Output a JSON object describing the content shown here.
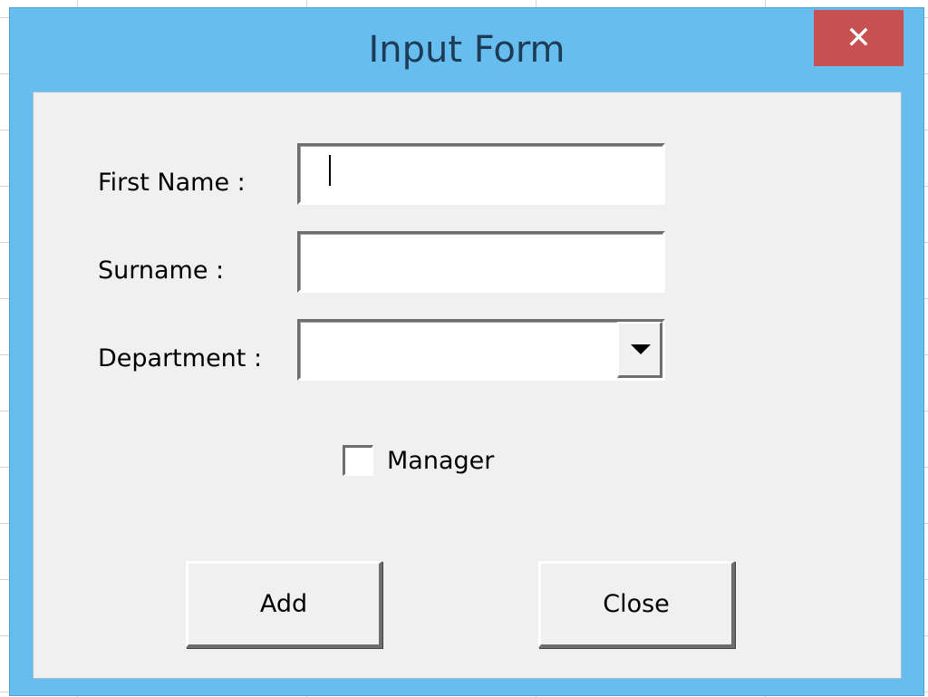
{
  "window": {
    "title": "Input Form",
    "close_glyph": "✕"
  },
  "form": {
    "first_name": {
      "label": "First Name :",
      "value": ""
    },
    "surname": {
      "label": "Surname :",
      "value": ""
    },
    "department": {
      "label": "Department :",
      "selected": ""
    },
    "manager": {
      "label": "Manager",
      "checked": false
    }
  },
  "buttons": {
    "add_label": "Add",
    "close_label": "Close"
  },
  "colors": {
    "title_bar": "#67bdee",
    "close_button": "#c75050",
    "client_background": "#f0f0f0"
  },
  "icons": {
    "close": "close-icon",
    "dropdown": "chevron-down-icon"
  }
}
